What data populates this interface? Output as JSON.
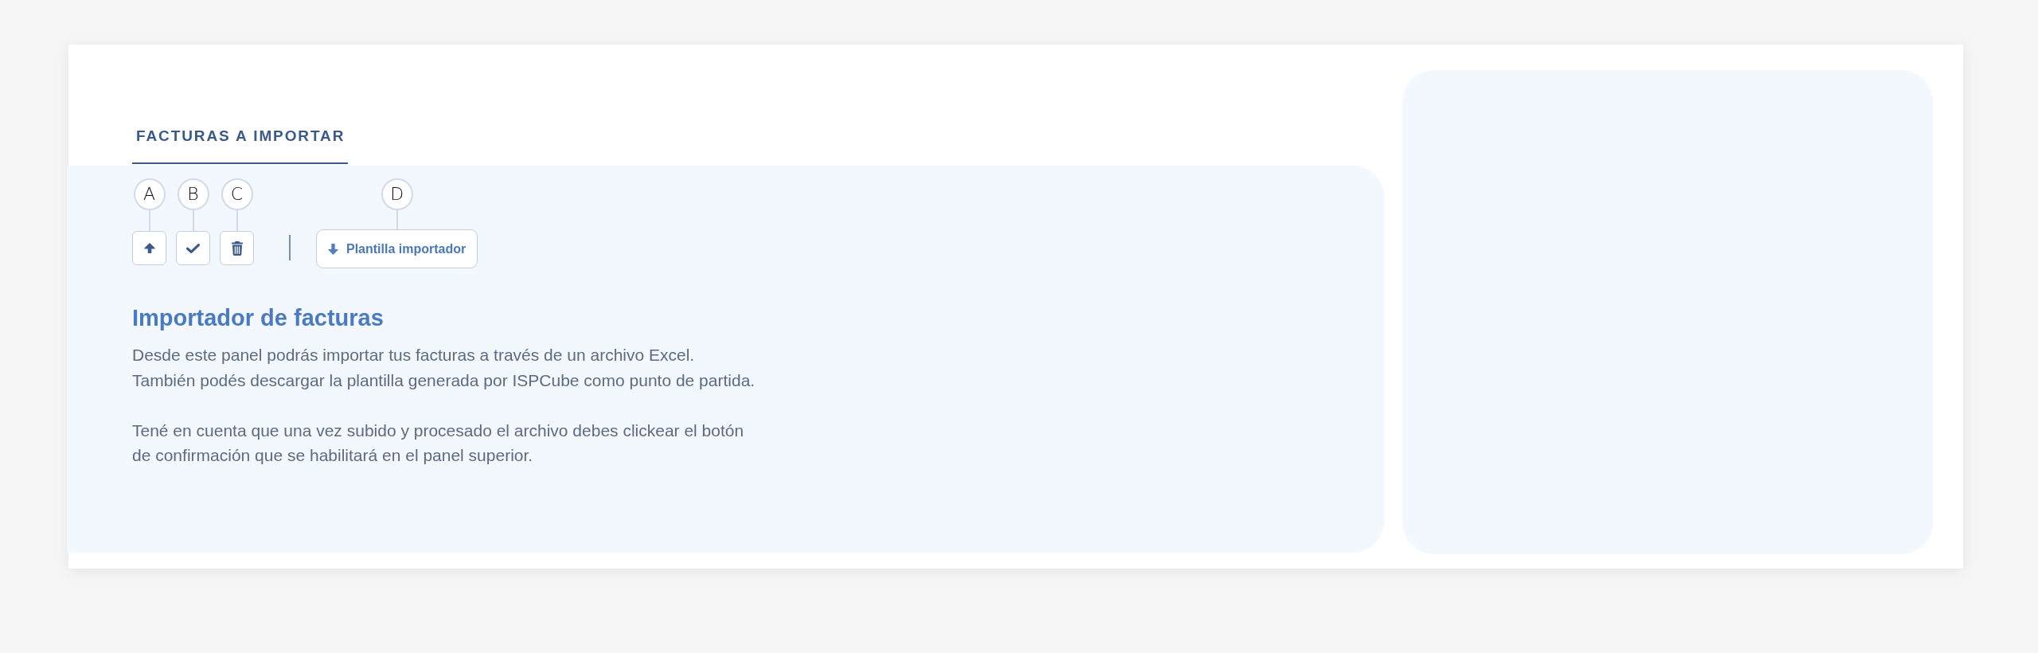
{
  "tabs": [
    {
      "label": "FACTURAS A IMPORTAR",
      "selected": true
    }
  ],
  "toolbar": {
    "groups": [
      {
        "tools": [
          {
            "kind": "upload",
            "callout": "A"
          },
          {
            "kind": "confirm",
            "callout": "B"
          },
          {
            "kind": "delete",
            "callout": "C"
          }
        ]
      },
      {
        "tools": [
          {
            "kind": "download",
            "callout": "D",
            "label": "Plantilla importador"
          }
        ]
      }
    ]
  },
  "panel": {
    "title": "Importador de facturas",
    "paragraphs": [
      {
        "lines": [
          "Desde este panel podrás importar tus facturas a través de un archivo Excel.",
          "También podés descargar la plantilla generada por ISPCube como punto de partida."
        ]
      },
      {
        "lines": [
          "Tené en cuenta que una vez subido y procesado el archivo debes clickear el botón",
          "de confirmación que se habilitará en el panel superior."
        ]
      }
    ]
  }
}
